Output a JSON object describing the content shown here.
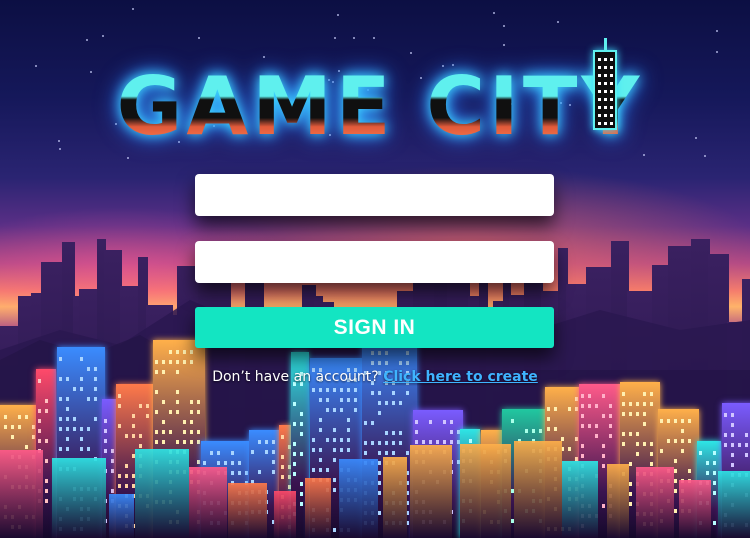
{
  "logo": {
    "text": "GAME CITY",
    "colors": {
      "top": "#5ff0ee",
      "middle": "#101010",
      "bottom": "#e25a3a",
      "glow": "#3fe0ff"
    }
  },
  "login_form": {
    "username": {
      "value": "",
      "placeholder": ""
    },
    "password": {
      "value": "",
      "placeholder": ""
    },
    "signin_label": "SIGN IN",
    "signin_color": "#13e5c2",
    "account_prompt": "Don’t have an account?",
    "create_link_label": "Click here to create",
    "link_color": "#3fb4ff"
  },
  "background": {
    "description_icon": "neon-city-skyline-image"
  }
}
